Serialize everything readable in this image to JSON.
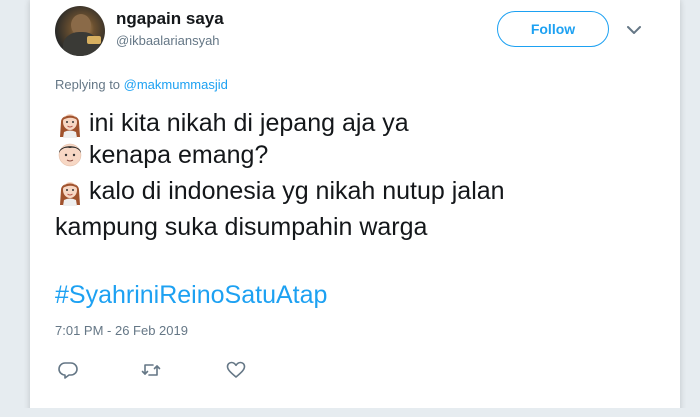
{
  "tweet": {
    "author_name": "ngapain saya",
    "author_handle": "@ikbaalariansyah",
    "follow_label": "Follow",
    "replying_prefix": "Replying to ",
    "replying_to": "@makmummasjid",
    "lines": [
      {
        "emoji": "woman-emoji",
        "text": "ini kita nikah di jepang aja ya"
      },
      {
        "emoji": "man-emoji",
        "text": "kenapa emang?"
      },
      {
        "emoji": "woman-emoji",
        "text": "kalo di indonesia yg nikah nutup jalan"
      },
      {
        "emoji": "",
        "text": "kampung suka disumpahin warga"
      }
    ],
    "hashtag": "#SyahriniReinoSatuAtap",
    "timestamp": "7:01 PM - 26 Feb 2019",
    "actions": [
      "reply-icon",
      "retweet-icon",
      "like-icon"
    ]
  },
  "colors": {
    "accent": "#1da1f2",
    "text": "#14171a",
    "muted": "#657786",
    "background": "#e6ecf0"
  }
}
